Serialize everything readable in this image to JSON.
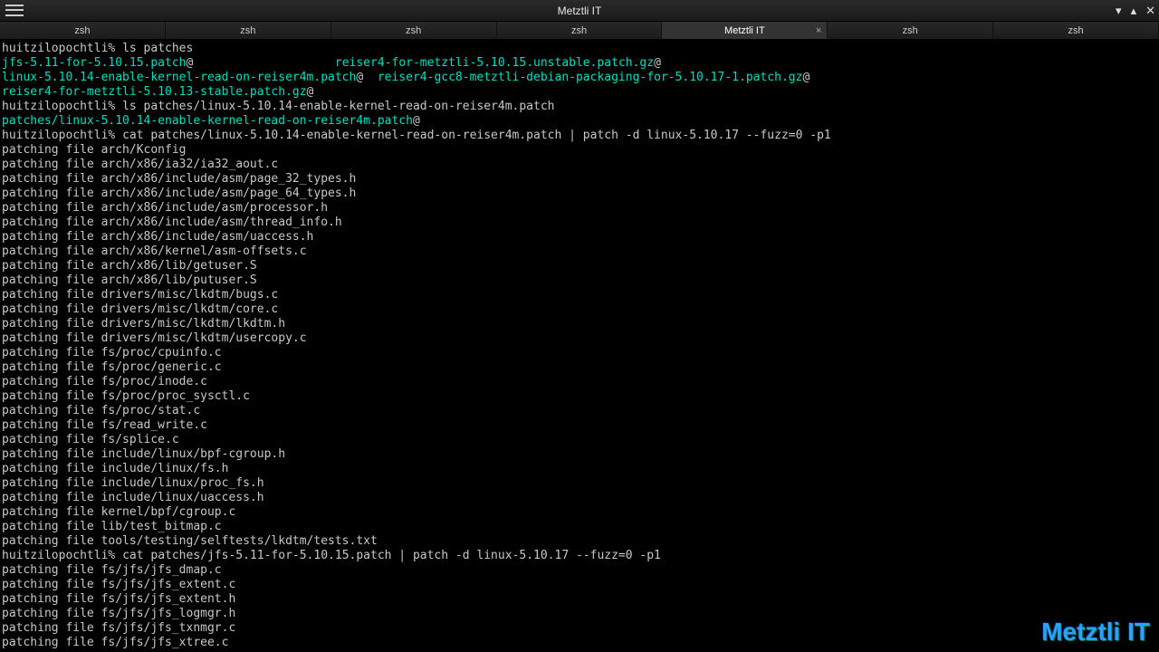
{
  "window": {
    "title": "Metztli IT"
  },
  "tabs": [
    {
      "label": "zsh"
    },
    {
      "label": "zsh"
    },
    {
      "label": "zsh"
    },
    {
      "label": "zsh"
    },
    {
      "label": "Metztli IT",
      "active": true,
      "closable": true
    },
    {
      "label": "zsh"
    },
    {
      "label": "zsh"
    }
  ],
  "watermark": "Metztli IT",
  "lines": [
    {
      "segments": [
        {
          "cls": "prompt",
          "t": "huitzilopochtli% "
        },
        {
          "cls": "cmd",
          "t": "ls patches"
        }
      ]
    },
    {
      "segments": [
        {
          "cls": "file-cyan",
          "t": "jfs-5.11-for-5.10.15.patch"
        },
        {
          "cls": "output",
          "t": "@                    "
        },
        {
          "cls": "file-cyan",
          "t": "reiser4-for-metztli-5.10.15.unstable.patch.gz"
        },
        {
          "cls": "output",
          "t": "@"
        }
      ]
    },
    {
      "segments": [
        {
          "cls": "file-cyan",
          "t": "linux-5.10.14-enable-kernel-read-on-reiser4m.patch"
        },
        {
          "cls": "output",
          "t": "@  "
        },
        {
          "cls": "file-cyan",
          "t": "reiser4-gcc8-metztli-debian-packaging-for-5.10.17-1.patch.gz"
        },
        {
          "cls": "output",
          "t": "@"
        }
      ]
    },
    {
      "segments": [
        {
          "cls": "file-cyan",
          "t": "reiser4-for-metztli-5.10.13-stable.patch.gz"
        },
        {
          "cls": "output",
          "t": "@"
        }
      ]
    },
    {
      "segments": [
        {
          "cls": "prompt",
          "t": "huitzilopochtli% "
        },
        {
          "cls": "cmd",
          "t": "ls patches/linux-5.10.14-enable-kernel-read-on-reiser4m.patch"
        }
      ]
    },
    {
      "segments": [
        {
          "cls": "file-cyan",
          "t": "patches/linux-5.10.14-enable-kernel-read-on-reiser4m.patch"
        },
        {
          "cls": "output",
          "t": "@"
        }
      ]
    },
    {
      "segments": [
        {
          "cls": "prompt",
          "t": "huitzilopochtli% "
        },
        {
          "cls": "cmd",
          "t": "cat patches/linux-5.10.14-enable-kernel-read-on-reiser4m.patch | patch -d linux-5.10.17 --fuzz=0 -p1"
        }
      ]
    },
    {
      "segments": [
        {
          "cls": "output",
          "t": "patching file arch/Kconfig"
        }
      ]
    },
    {
      "segments": [
        {
          "cls": "output",
          "t": "patching file arch/x86/ia32/ia32_aout.c"
        }
      ]
    },
    {
      "segments": [
        {
          "cls": "output",
          "t": "patching file arch/x86/include/asm/page_32_types.h"
        }
      ]
    },
    {
      "segments": [
        {
          "cls": "output",
          "t": "patching file arch/x86/include/asm/page_64_types.h"
        }
      ]
    },
    {
      "segments": [
        {
          "cls": "output",
          "t": "patching file arch/x86/include/asm/processor.h"
        }
      ]
    },
    {
      "segments": [
        {
          "cls": "output",
          "t": "patching file arch/x86/include/asm/thread_info.h"
        }
      ]
    },
    {
      "segments": [
        {
          "cls": "output",
          "t": "patching file arch/x86/include/asm/uaccess.h"
        }
      ]
    },
    {
      "segments": [
        {
          "cls": "output",
          "t": "patching file arch/x86/kernel/asm-offsets.c"
        }
      ]
    },
    {
      "segments": [
        {
          "cls": "output",
          "t": "patching file arch/x86/lib/getuser.S"
        }
      ]
    },
    {
      "segments": [
        {
          "cls": "output",
          "t": "patching file arch/x86/lib/putuser.S"
        }
      ]
    },
    {
      "segments": [
        {
          "cls": "output",
          "t": "patching file drivers/misc/lkdtm/bugs.c"
        }
      ]
    },
    {
      "segments": [
        {
          "cls": "output",
          "t": "patching file drivers/misc/lkdtm/core.c"
        }
      ]
    },
    {
      "segments": [
        {
          "cls": "output",
          "t": "patching file drivers/misc/lkdtm/lkdtm.h"
        }
      ]
    },
    {
      "segments": [
        {
          "cls": "output",
          "t": "patching file drivers/misc/lkdtm/usercopy.c"
        }
      ]
    },
    {
      "segments": [
        {
          "cls": "output",
          "t": "patching file fs/proc/cpuinfo.c"
        }
      ]
    },
    {
      "segments": [
        {
          "cls": "output",
          "t": "patching file fs/proc/generic.c"
        }
      ]
    },
    {
      "segments": [
        {
          "cls": "output",
          "t": "patching file fs/proc/inode.c"
        }
      ]
    },
    {
      "segments": [
        {
          "cls": "output",
          "t": "patching file fs/proc/proc_sysctl.c"
        }
      ]
    },
    {
      "segments": [
        {
          "cls": "output",
          "t": "patching file fs/proc/stat.c"
        }
      ]
    },
    {
      "segments": [
        {
          "cls": "output",
          "t": "patching file fs/read_write.c"
        }
      ]
    },
    {
      "segments": [
        {
          "cls": "output",
          "t": "patching file fs/splice.c"
        }
      ]
    },
    {
      "segments": [
        {
          "cls": "output",
          "t": "patching file include/linux/bpf-cgroup.h"
        }
      ]
    },
    {
      "segments": [
        {
          "cls": "output",
          "t": "patching file include/linux/fs.h"
        }
      ]
    },
    {
      "segments": [
        {
          "cls": "output",
          "t": "patching file include/linux/proc_fs.h"
        }
      ]
    },
    {
      "segments": [
        {
          "cls": "output",
          "t": "patching file include/linux/uaccess.h"
        }
      ]
    },
    {
      "segments": [
        {
          "cls": "output",
          "t": "patching file kernel/bpf/cgroup.c"
        }
      ]
    },
    {
      "segments": [
        {
          "cls": "output",
          "t": "patching file lib/test_bitmap.c"
        }
      ]
    },
    {
      "segments": [
        {
          "cls": "output",
          "t": "patching file tools/testing/selftests/lkdtm/tests.txt"
        }
      ]
    },
    {
      "segments": [
        {
          "cls": "prompt",
          "t": "huitzilopochtli% "
        },
        {
          "cls": "cmd",
          "t": "cat patches/jfs-5.11-for-5.10.15.patch | patch -d linux-5.10.17 --fuzz=0 -p1"
        }
      ]
    },
    {
      "segments": [
        {
          "cls": "output",
          "t": "patching file fs/jfs/jfs_dmap.c"
        }
      ]
    },
    {
      "segments": [
        {
          "cls": "output",
          "t": "patching file fs/jfs/jfs_extent.c"
        }
      ]
    },
    {
      "segments": [
        {
          "cls": "output",
          "t": "patching file fs/jfs/jfs_extent.h"
        }
      ]
    },
    {
      "segments": [
        {
          "cls": "output",
          "t": "patching file fs/jfs/jfs_logmgr.h"
        }
      ]
    },
    {
      "segments": [
        {
          "cls": "output",
          "t": "patching file fs/jfs/jfs_txnmgr.c"
        }
      ]
    },
    {
      "segments": [
        {
          "cls": "output",
          "t": "patching file fs/jfs/jfs_xtree.c"
        }
      ]
    }
  ]
}
